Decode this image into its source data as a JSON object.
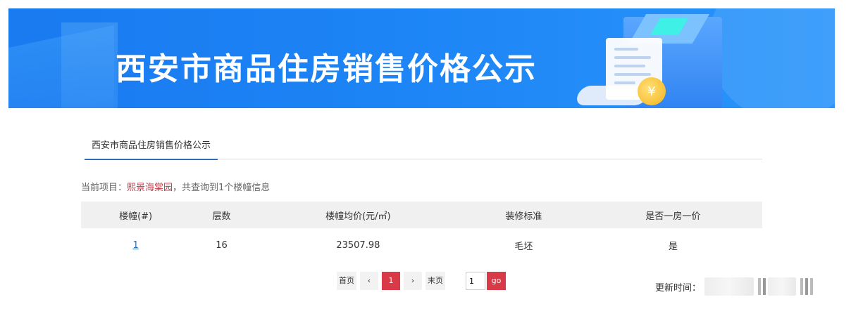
{
  "banner": {
    "title": "西安市商品住房销售价格公示",
    "coin_symbol": "¥",
    "color": "#1a7af0"
  },
  "tabs": [
    {
      "label": "西安市商品住房销售价格公示",
      "active": true
    }
  ],
  "info": {
    "prefix": "当前项目：",
    "project_name": "熙景海棠园",
    "suffix": "，共查询到1个楼幢信息"
  },
  "table": {
    "headers": [
      "楼幢(#)",
      "层数",
      "楼幢均价(元/㎡)",
      "装修标准",
      "是否一房一价"
    ],
    "rows": [
      [
        "1",
        "16",
        "23507.98",
        "毛坯",
        "是"
      ]
    ]
  },
  "pager": {
    "first": "首页",
    "prev": "‹",
    "current": "1",
    "next": "›",
    "last": "末页",
    "input_value": "1",
    "go": "go",
    "accent": "#d93a48"
  },
  "updated": {
    "label": "更新时间："
  }
}
